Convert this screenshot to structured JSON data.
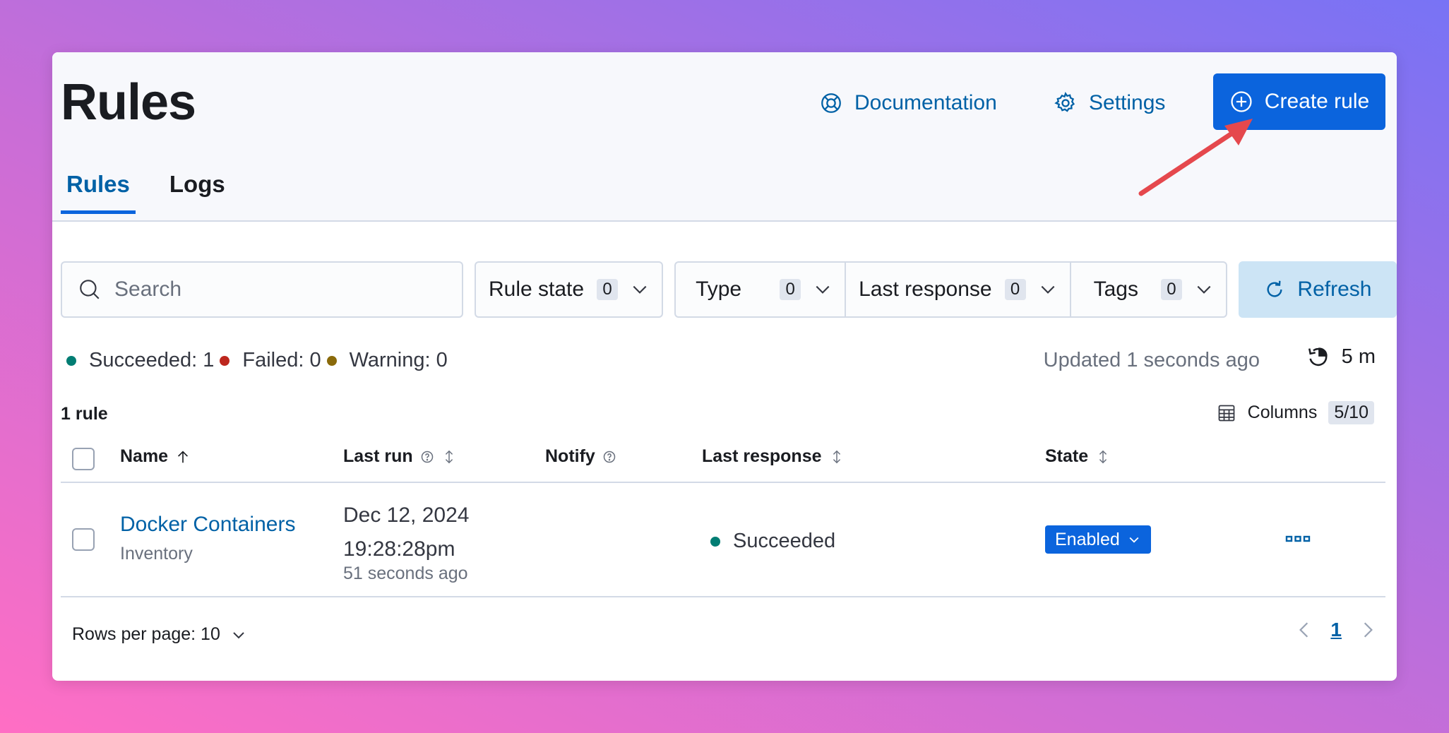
{
  "header": {
    "title": "Rules",
    "documentation_label": "Documentation",
    "settings_label": "Settings",
    "create_rule_label": "Create rule"
  },
  "tabs": [
    {
      "label": "Rules",
      "active": true
    },
    {
      "label": "Logs",
      "active": false
    }
  ],
  "toolbar": {
    "search_placeholder": "Search",
    "filters": [
      {
        "label": "Rule state",
        "count": "0"
      },
      {
        "label": "Type",
        "count": "0"
      },
      {
        "label": "Last response",
        "count": "0"
      },
      {
        "label": "Tags",
        "count": "0"
      }
    ],
    "refresh_label": "Refresh"
  },
  "status": {
    "succeeded": "Succeeded: 1",
    "failed": "Failed: 0",
    "warning": "Warning: 0",
    "updated": "Updated 1 seconds ago",
    "interval": "5 m"
  },
  "table": {
    "rule_count": "1 rule",
    "columns_label": "Columns",
    "columns_count": "5/10",
    "headers": {
      "name": "Name",
      "last_run": "Last run",
      "notify": "Notify",
      "last_response": "Last response",
      "state": "State"
    },
    "rows": [
      {
        "name": "Docker Containers",
        "type": "Inventory",
        "last_run_date": "Dec 12, 2024\n19:28:28pm",
        "last_run_ago": "51 seconds ago",
        "last_response": "Succeeded",
        "state": "Enabled"
      }
    ]
  },
  "footer": {
    "rows_per_page": "Rows per page: 10",
    "current_page": "1"
  },
  "colors": {
    "primary": "#0b64dd",
    "link": "#0061a6",
    "success": "#017d73",
    "danger": "#bd271e",
    "warning": "#8a6a0a",
    "annotation_arrow": "#e5484d"
  }
}
